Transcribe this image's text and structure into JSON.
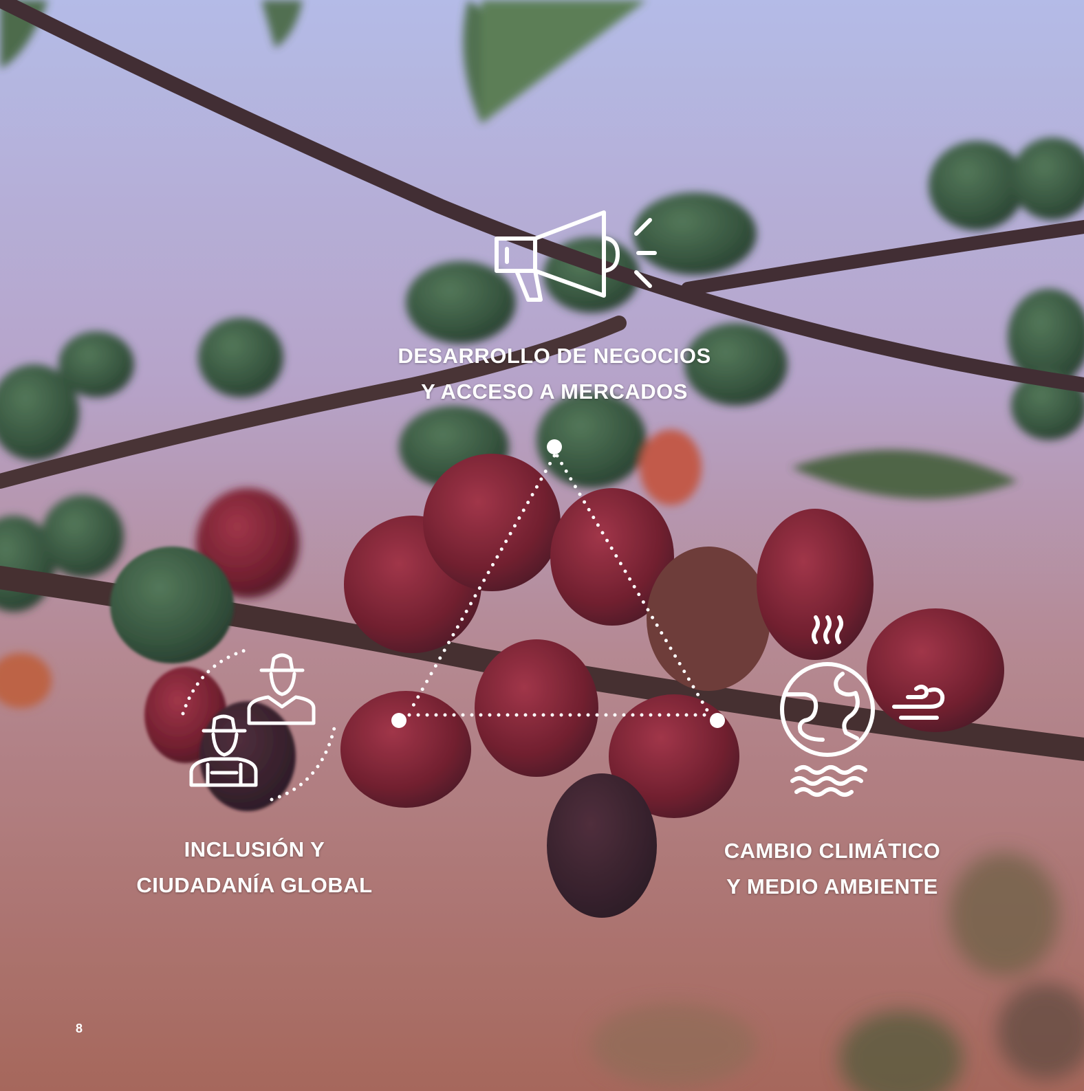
{
  "background": {
    "sky_top": "#b8c4ec",
    "sky_bottom": "#b27568",
    "berry_red": "#7a1f2e",
    "berry_green": "#2f5a3c",
    "branch": "#3e2a2a"
  },
  "diagram": {
    "accent": "#ffffff",
    "top": {
      "icon": "megaphone-icon",
      "label_line1": "DESARROLLO DE NEGOCIOS",
      "label_line2": "Y ACCESO A MERCADOS"
    },
    "left": {
      "icon": "people-icon",
      "label_line1": "INCLUSIÓN Y",
      "label_line2": "CIUDADANÍA GLOBAL"
    },
    "right": {
      "icon": "earth-climate-icon",
      "label_line1": "CAMBIO CLIMÁTICO",
      "label_line2": "Y MEDIO AMBIENTE"
    }
  },
  "page_number": "8"
}
